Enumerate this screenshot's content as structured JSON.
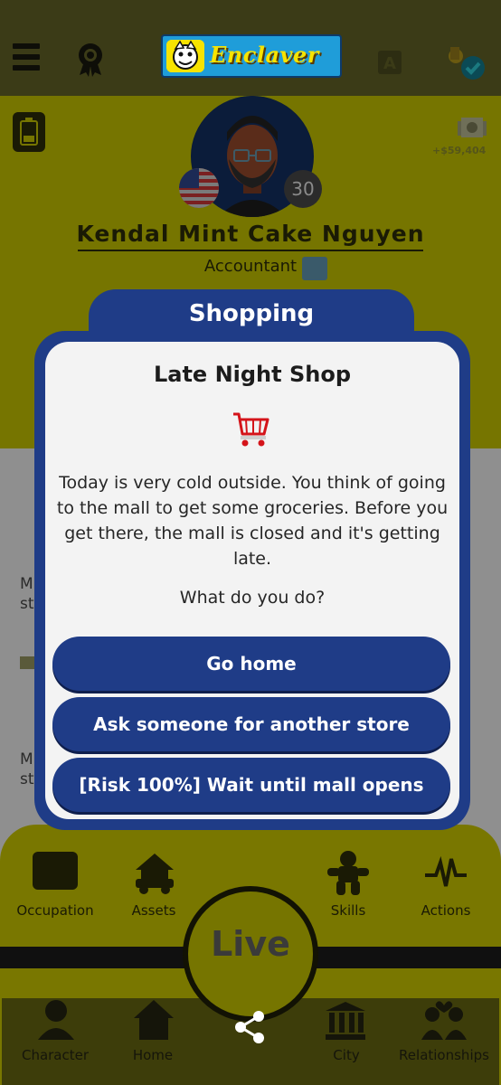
{
  "app": {
    "logo_text": "Enclaver"
  },
  "profile": {
    "money": "+$59,404",
    "age": "30",
    "name": "Kendal Mint Cake Nguyen",
    "job": "Accountant"
  },
  "background_list": {
    "row1_text": "M",
    "row1_sub": "st",
    "row3_text": "M",
    "row3_sub": "st"
  },
  "nav": {
    "occupation": "Occupation",
    "assets": "Assets",
    "skills": "Skills",
    "actions": "Actions",
    "live": "Live"
  },
  "tabs": {
    "character": "Character",
    "home": "Home",
    "city": "City",
    "relationships": "Relationships"
  },
  "modal": {
    "title": "Shopping",
    "heading": "Late Night Shop",
    "body": "Today is very cold outside. You think of going to the mall to get some groceries. Before you get there, the mall is closed and it's getting late.",
    "question": "What do you do?",
    "choices": [
      "Go home",
      "Ask someone for another store",
      "[Risk 100%] Wait until mall opens"
    ]
  },
  "colors": {
    "modal_blue": "#1f3c87",
    "yellow_dimmed": "#767500",
    "card_bg": "#f3f3f3"
  }
}
